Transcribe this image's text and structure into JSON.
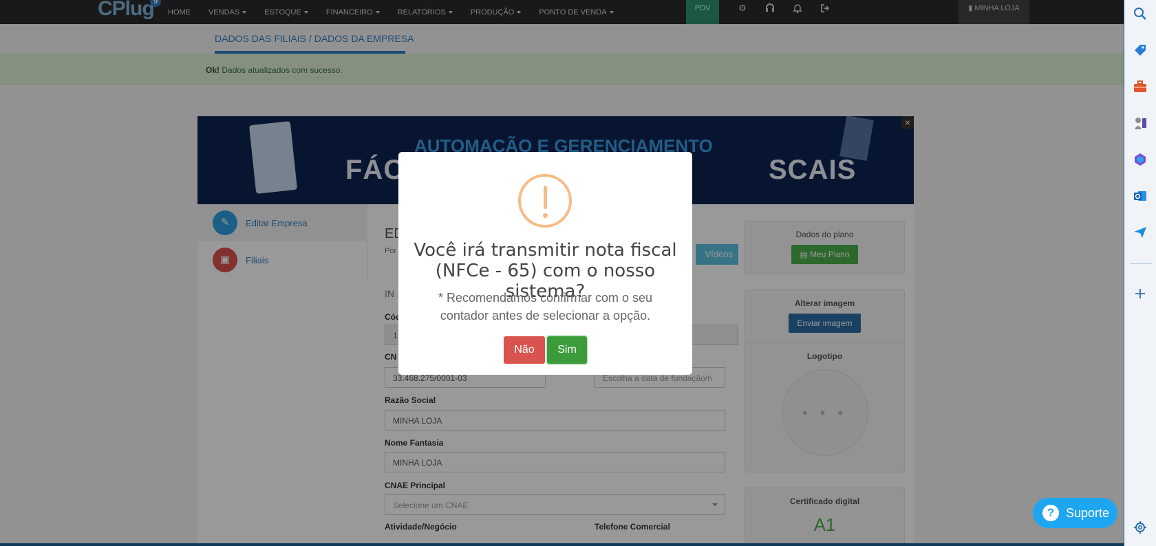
{
  "nav": {
    "logo": "CPlug",
    "logo_badge": "9",
    "menu": [
      {
        "label": "HOME",
        "caret": false
      },
      {
        "label": "VENDAS",
        "caret": true
      },
      {
        "label": "ESTOQUE",
        "caret": true
      },
      {
        "label": "FINANCEIRO",
        "caret": true
      },
      {
        "label": "RELATÓRIOS",
        "caret": true
      },
      {
        "label": "PRODUÇÃO",
        "caret": true
      },
      {
        "label": "PONTO DE VENDA",
        "caret": true
      }
    ],
    "pdv": "PDV",
    "store": "MINHA LOJA"
  },
  "tabs": {
    "title": "DADOS DAS FILIAIS / DADOS DA EMPRESA"
  },
  "alert": {
    "strong": "Ok!",
    "text": " Dados atualizados com sucesso."
  },
  "banner": {
    "line1": "AUTOMAÇÃO E GERENCIAMENTO",
    "line2_left": "FÁC",
    "line2_right": "SCAIS"
  },
  "sidenav": [
    {
      "label": "Editar Empresa",
      "color": "#2f7fc1"
    },
    {
      "label": "Filiais",
      "color": "#d9534f"
    }
  ],
  "form": {
    "title": "ED",
    "subtitle": "Por",
    "videos_btn": "Vídeos",
    "section": "IN",
    "codigo_label": "Cód",
    "codigo_value": "1",
    "cnpj_label": "CN",
    "cnpj_value": "33.468.275/0001-03",
    "data_placeholder": "Escolha a data de fundação/n",
    "razao_label": "Razão Social",
    "razao_value": "MINHA LOJA",
    "fantasia_label": "Nome Fantasia",
    "fantasia_value": "MINHA LOJA",
    "cnae_label": "CNAE Principal",
    "cnae_placeholder": "Selecione um CNAE",
    "atividade_label": "Atividade/Negócio",
    "telefone_label": "Telefone Comercial"
  },
  "right": {
    "plano_title": "Dados do plano",
    "plano_btn": "Meu Plano",
    "imagem_title": "Alterar imagem",
    "imagem_btn": "Enviar imagem",
    "logotipo_title": "Logotipo",
    "logo_placeholder": "• • •",
    "cert_title": "Certificado digital",
    "cert_value": "A1"
  },
  "modal": {
    "title": "Você irá transmitir nota fiscal (NFCe - 65) com o nosso sistema?",
    "text": "* Recomendamos confirmar com o seu contador antes de selecionar a opção.",
    "no": "Não",
    "yes": "Sim"
  },
  "suporte": "Suporte"
}
